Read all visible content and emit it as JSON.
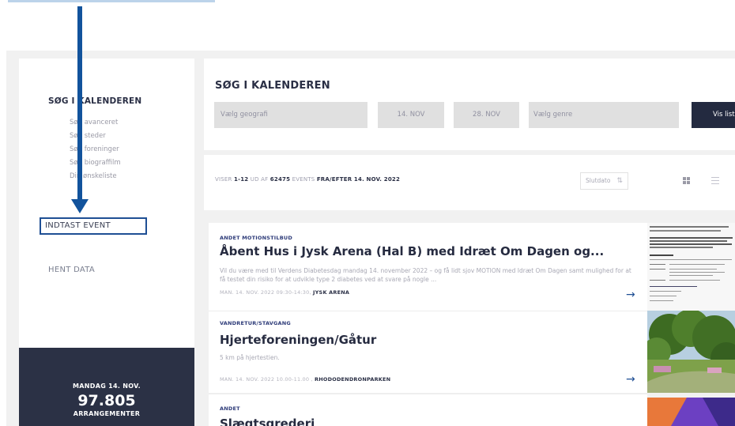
{
  "sidebar": {
    "title": "SØG I KALENDEREN",
    "links": [
      {
        "label": "Søg avanceret"
      },
      {
        "label": "Søg steder"
      },
      {
        "label": "Søg foreninger"
      },
      {
        "label": "Søg biograffilm"
      },
      {
        "label": "Din ønskeliste"
      }
    ],
    "indtast": "INDTAST EVENT",
    "hent": "HENT DATA",
    "date": "MANDAG 14. NOV.",
    "count": "97.805",
    "count_label": "ARRANGEMENTER"
  },
  "search": {
    "title": "SØG I KALENDEREN",
    "geo": "Vælg geografi",
    "date_from": "14. NOV",
    "date_to": "28. NOV",
    "genre": "Vælg genre",
    "button": "Vis liste"
  },
  "results": {
    "prefix": "VISER",
    "range": "1-12",
    "mid": "UD AF",
    "total": "62475",
    "events_word": "EVENTS",
    "suffix": "FRA/EFTER 14. NOV. 2022",
    "sort_label": "Slutdato"
  },
  "events": [
    {
      "category": "ANDET MOTIONSTILBUD",
      "title": "Åbent Hus i Jysk Arena (Hal B) med Idræt Om Dagen og...",
      "description": "Vil du være med til Verdens Diabetesdag mandag 14. november 2022 – og få lidt sjov MOTION med Idræt Om Dagen samt mulighed for at få testet din risiko for at udvikle type 2 diabetes ved at svare på nogle ...",
      "meta": "MAN. 14. NOV. 2022 09:30-14:30,",
      "place": "JYSK ARENA"
    },
    {
      "category": "VANDRETUR/STAVGANG",
      "title": "Hjerteforeningen/Gåtur",
      "description": "5 km på hjertestien.",
      "meta": "MAN. 14. NOV. 2022 10.00-11.00 ,",
      "place": "RHODODENDRONPARKEN"
    },
    {
      "category": "ANDET",
      "title": "Slægtsgrederi"
    }
  ],
  "colors": {
    "dark": "#2b3145",
    "accent": "#1f4f94",
    "category": "#2c3a78"
  }
}
